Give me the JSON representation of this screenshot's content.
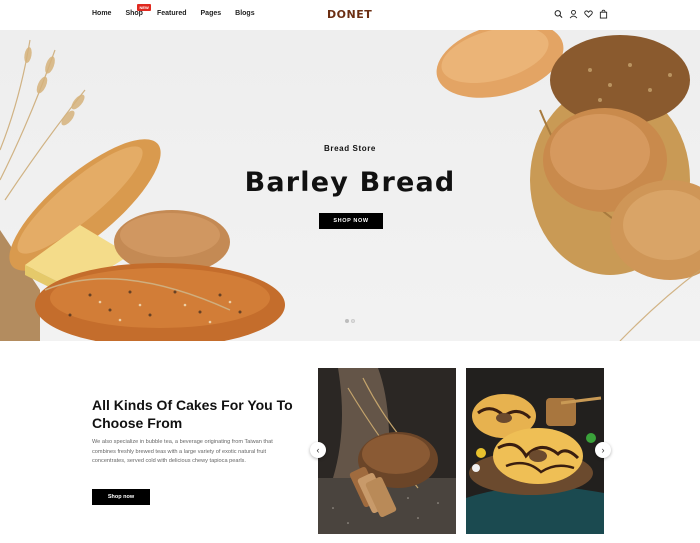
{
  "nav": {
    "items": [
      {
        "label": "Home"
      },
      {
        "label": "Shop",
        "badge": "NEW"
      },
      {
        "label": "Featured"
      },
      {
        "label": "Pages"
      },
      {
        "label": "Blogs"
      }
    ]
  },
  "logo": "DONET",
  "header_icons": [
    "search-icon",
    "user-icon",
    "heart-icon",
    "bag-icon"
  ],
  "hero": {
    "subtitle": "Bread Store",
    "title": "Barley Bread",
    "button": "SHOP NOW",
    "slides": 2,
    "active_slide": 1
  },
  "section": {
    "title": "All Kinds Of Cakes For You To Choose From",
    "description": "We also specialize in bubble tea, a beverage originating from Taiwan that combines freshly brewed teas with a large variety of exotic natural fruit concentrates, served cold with delicious chewy tapioca pearls.",
    "button": "Shop now"
  },
  "carousel": {
    "prev": "‹",
    "next": "›"
  },
  "colors": {
    "accent": "#000000",
    "logo": "#6b2e12",
    "badge": "#e0291f"
  }
}
